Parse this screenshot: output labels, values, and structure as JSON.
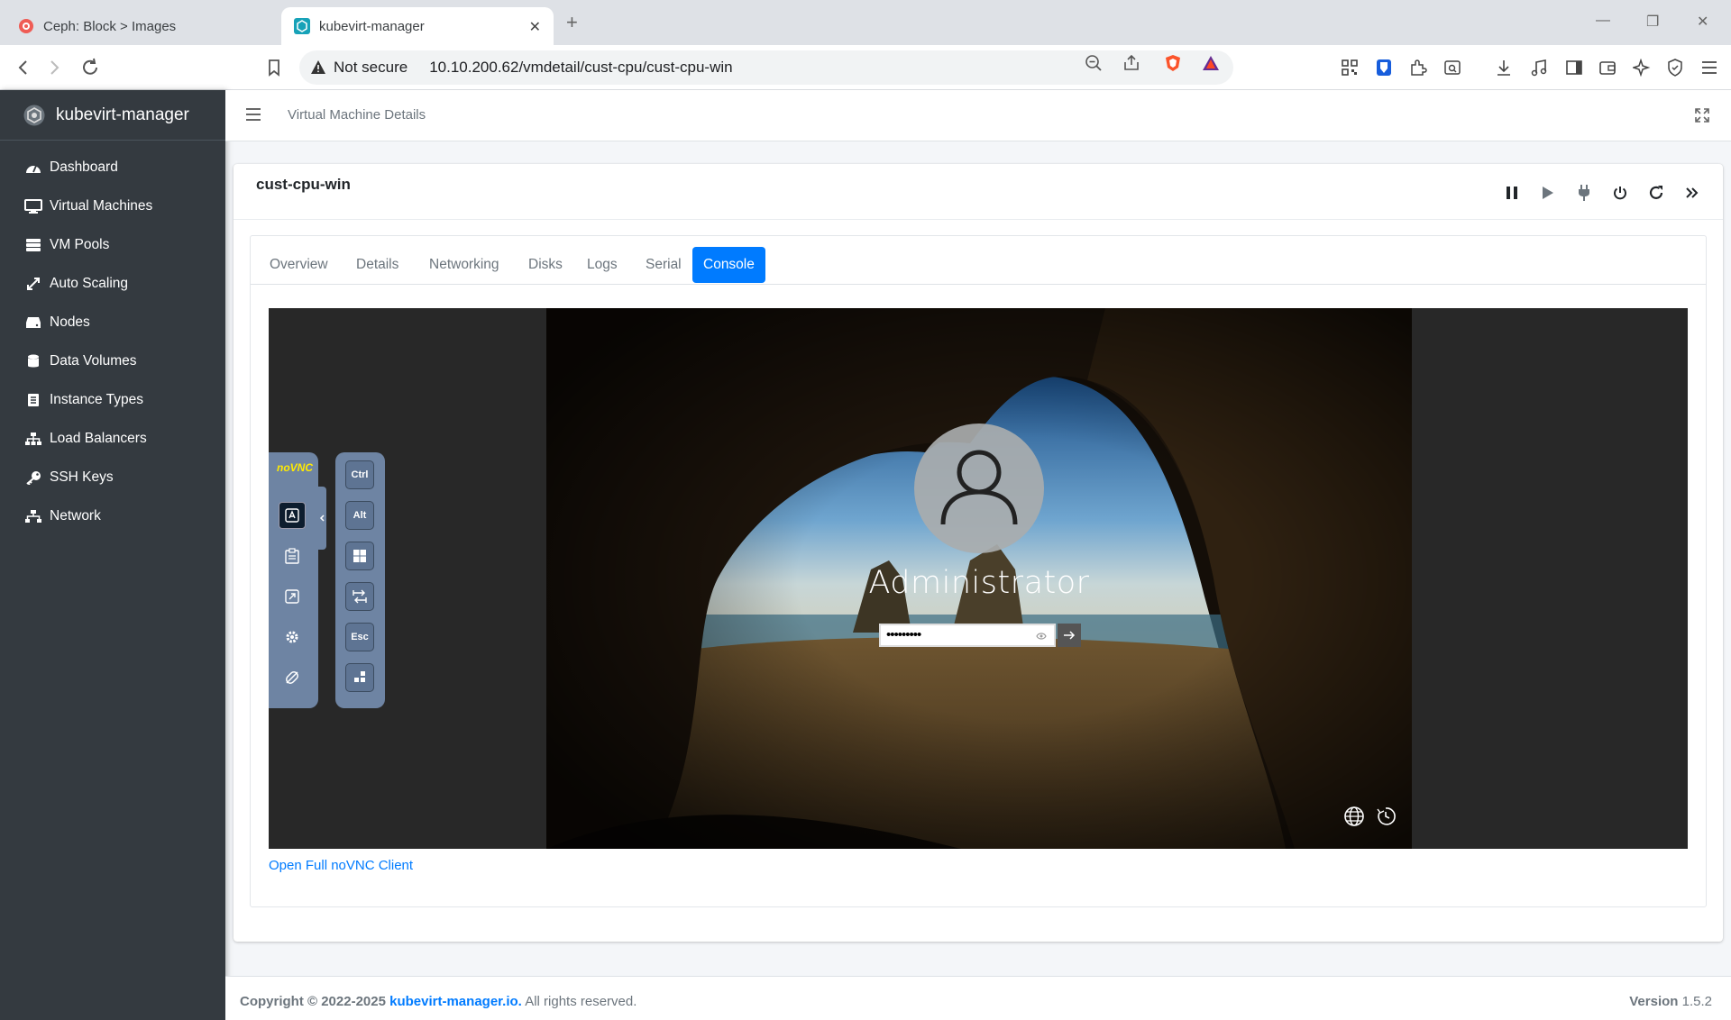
{
  "browser": {
    "tabs": [
      {
        "title": "Ceph: Block > Images",
        "active": false
      },
      {
        "title": "kubevirt-manager",
        "active": true
      }
    ],
    "security": "Not secure",
    "url": "10.10.200.62/vmdetail/cust-cpu/cust-cpu-win"
  },
  "app": {
    "brand": "kubevirt-manager",
    "breadcrumb": "Virtual Machine Details",
    "sidebar": [
      {
        "label": "Dashboard",
        "icon": "dashboard-icon"
      },
      {
        "label": "Virtual Machines",
        "icon": "desktop-icon"
      },
      {
        "label": "VM Pools",
        "icon": "server-icon"
      },
      {
        "label": "Auto Scaling",
        "icon": "expand-arrows-icon"
      },
      {
        "label": "Nodes",
        "icon": "hdd-icon"
      },
      {
        "label": "Data Volumes",
        "icon": "database-icon"
      },
      {
        "label": "Instance Types",
        "icon": "list-icon"
      },
      {
        "label": "Load Balancers",
        "icon": "sitemap-icon"
      },
      {
        "label": "SSH Keys",
        "icon": "key-icon"
      },
      {
        "label": "Network",
        "icon": "network-icon"
      }
    ]
  },
  "vm": {
    "name": "cust-cpu-win",
    "tabs": [
      {
        "label": "Overview"
      },
      {
        "label": "Details"
      },
      {
        "label": "Networking"
      },
      {
        "label": "Disks"
      },
      {
        "label": "Logs"
      },
      {
        "label": "Serial"
      },
      {
        "label": "Console",
        "active": true
      }
    ],
    "console": {
      "username": "Administrator",
      "password_mask": "•••••••••",
      "keys": [
        "Ctrl",
        "Alt",
        "Esc"
      ],
      "open_link": "Open Full noVNC Client",
      "novnc_logo": "noVNC"
    }
  },
  "footer": {
    "copyright": "Copyright © 2022-2025",
    "link": "kubevirt-manager.io.",
    "rights": "All rights reserved.",
    "version_label": "Version",
    "version": "1.5.2"
  }
}
